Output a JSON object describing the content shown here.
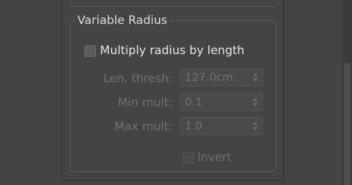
{
  "group": {
    "title": "Variable Radius"
  },
  "multiply_checkbox": {
    "label": "Multiply radius by length",
    "checked": false
  },
  "params": [
    {
      "label": "Len. thresh:",
      "value": "127.0cm"
    },
    {
      "label": "Min mult:",
      "value": "0.1"
    },
    {
      "label": "Max mult:",
      "value": "1.0"
    }
  ],
  "invert_checkbox": {
    "label": "Invert",
    "checked": false
  },
  "colors": {
    "background": "#444444",
    "text_enabled": "#e6e6e6",
    "text_disabled": "#717171"
  }
}
